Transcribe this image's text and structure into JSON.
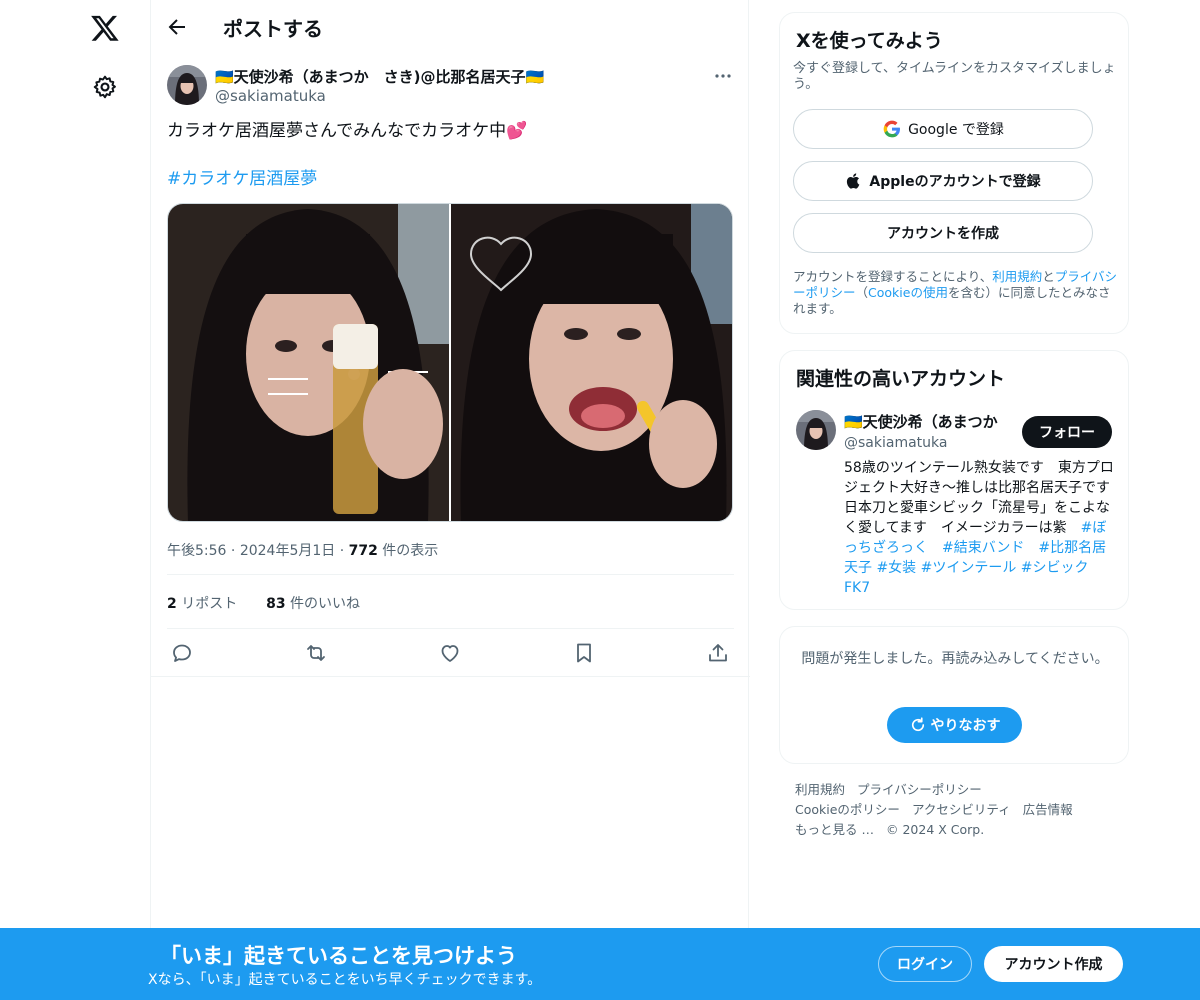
{
  "header": {
    "title": "ポストする"
  },
  "post": {
    "author_name": "🇺🇦天使沙希（あまつか　さき)@比那名居天子🇺🇦",
    "author_handle": "@sakiamatuka",
    "text": "カラオケ居酒屋夢さんでみんなでカラオケ中💕",
    "hashtag": "#カラオケ居酒屋夢",
    "meta_time": "午後5:56",
    "meta_date": "2024年5月1日",
    "meta_views_count": "772",
    "meta_views_label": " 件の表示",
    "reposts_count": "2",
    "reposts_label": " リポスト",
    "likes_count": "83",
    "likes_label": " 件のいいね"
  },
  "signup": {
    "title": "Xを使ってみよう",
    "subtitle": "今すぐ登録して、タイムラインをカスタマイズしましょう。",
    "google_label": "Google で登録",
    "apple_label": "Appleのアカウントで登録",
    "create_label": "アカウントを作成",
    "legal_prefix": "アカウントを登録することにより、",
    "legal_terms": "利用規約",
    "legal_and": "と",
    "legal_privacy": "プライバシーポリシー",
    "legal_open": "（",
    "legal_cookie": "Cookieの使用",
    "legal_suffix": "を含む）に同意したとみなされます。"
  },
  "related": {
    "title": "関連性の高いアカウント",
    "name": "🇺🇦天使沙希（あまつか",
    "handle": "@sakiamatuka",
    "follow_label": "フォロー",
    "bio": "58歳のツインテール熟女装です　東方プロジェクト大好き〜推しは比那名居天子です　日本刀と愛車シビック「流星号」をこよなく愛してます　イメージカラーは紫　",
    "bio_tags": "#ぼっちざろっく　#結束バンド　#比那名居天子 #女装 #ツインテール #シビックFK7"
  },
  "error": {
    "message": "問題が発生しました。再読み込みしてください。",
    "retry_label": "やりなおす"
  },
  "footer": {
    "terms": "利用規約",
    "privacy": "プライバシーポリシー",
    "cookie": "Cookieのポリシー",
    "accessibility": "アクセシビリティ",
    "ads": "広告情報",
    "more": "もっと見る …",
    "copyright": "© 2024 X Corp."
  },
  "bottom_bar": {
    "title": "「いま」起きていることを見つけよう",
    "subtitle": "Xなら、「いま」起きていることをいち早くチェックできます。",
    "login_label": "ログイン",
    "create_label": "アカウント作成"
  },
  "colors": {
    "accent": "#1d9bf0",
    "text_primary": "#0f1419",
    "text_secondary": "#536471",
    "border": "#eff3f4"
  },
  "icons": [
    "x-logo-icon",
    "gear-icon",
    "back-arrow-icon",
    "more-icon",
    "reply-icon",
    "repost-icon",
    "like-icon",
    "bookmark-icon",
    "share-icon",
    "google-icon",
    "apple-icon",
    "refresh-icon"
  ]
}
